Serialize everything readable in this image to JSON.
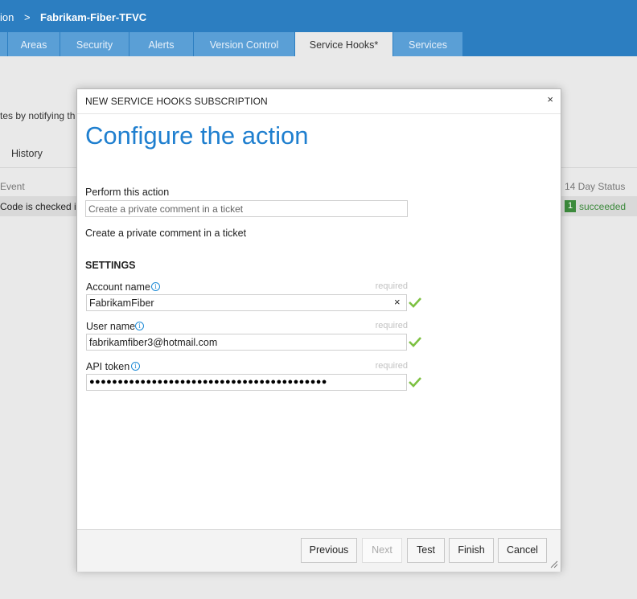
{
  "header": {
    "breadcrumb_left": "ion",
    "breadcrumb_sep": ">",
    "project": "Fabrikam-Fiber-TFVC"
  },
  "tabs": [
    {
      "label": ""
    },
    {
      "label": "Areas"
    },
    {
      "label": "Security"
    },
    {
      "label": "Alerts"
    },
    {
      "label": "Version Control"
    },
    {
      "label": "Service Hooks*"
    },
    {
      "label": "Services"
    }
  ],
  "background": {
    "description": "tes by notifying th",
    "history_tab": "History",
    "col_event": "Event",
    "col_status": "14 Day Status",
    "row_text": "Code is checked in",
    "row_badge": "1",
    "row_status": "succeeded"
  },
  "dialog": {
    "title": "NEW SERVICE HOOKS SUBSCRIPTION",
    "close_glyph": "×",
    "heading": "Configure the action",
    "perform_label": "Perform this action",
    "action_value": "Create a private comment in a ticket",
    "action_description": "Create a private comment in a ticket",
    "settings_title": "SETTINGS",
    "fields": [
      {
        "label": "Account name",
        "required": "required",
        "value": "FabrikamFiber"
      },
      {
        "label": "User name",
        "required": "required",
        "value": "fabrikamfiber3@hotmail.com"
      },
      {
        "label": "API token",
        "required": "required",
        "value": "●●●●●●●●●●●●●●●●●●●●●●●●●●●●●●●●●●●●●●●●●●"
      }
    ],
    "clear_glyph": "×",
    "buttons": {
      "previous": "Previous",
      "next": "Next",
      "test": "Test",
      "finish": "Finish",
      "cancel": "Cancel"
    }
  },
  "colors": {
    "header_blue": "#2c7ec1",
    "tab_blue": "#5a9fd6",
    "heading_blue": "#1f7fcf",
    "success_green": "#7dc142",
    "status_green": "#3c8a3c"
  }
}
